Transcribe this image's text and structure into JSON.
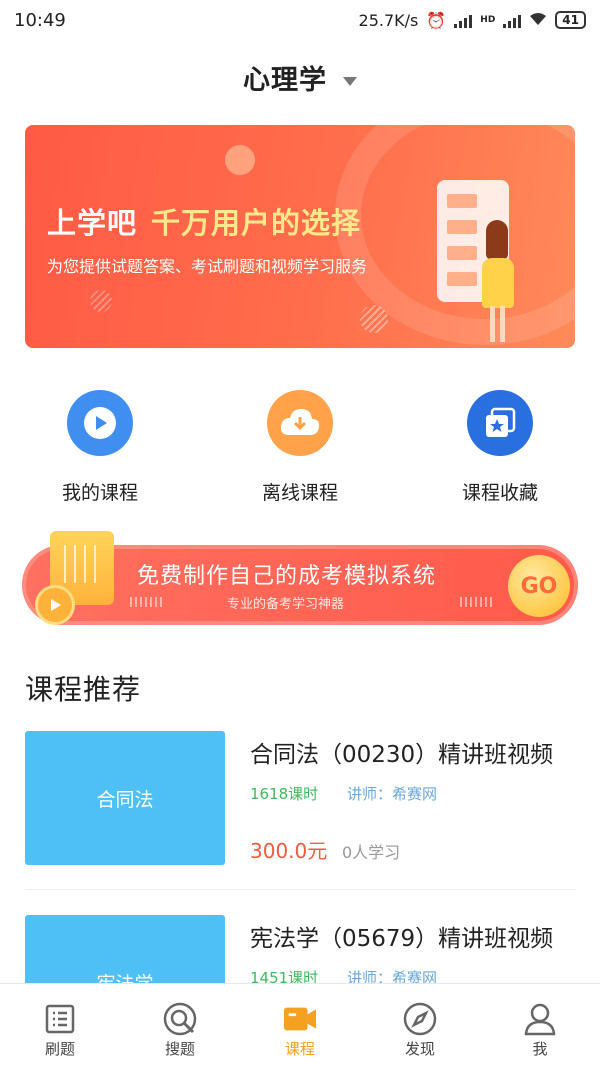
{
  "status": {
    "time": "10:49",
    "speed": "25.7K/s",
    "hd": "HD",
    "battery": "41"
  },
  "header": {
    "title": "心理学"
  },
  "banner": {
    "title_main": "上学吧",
    "title_highlight": "千万用户的选择",
    "subtitle": "为您提供试题答案、考试刷题和视频学习服务"
  },
  "quick_actions": [
    {
      "label": "我的课程",
      "icon": "play-circle-icon",
      "color": "#3f8ef0"
    },
    {
      "label": "离线课程",
      "icon": "cloud-download-icon",
      "color": "#ffa24a"
    },
    {
      "label": "课程收藏",
      "icon": "star-bookmark-icon",
      "color": "#2a6fe0"
    }
  ],
  "promo": {
    "title": "免费制作自己的成考模拟系统",
    "subtitle": "专业的备考学习神器",
    "go_label": "GO"
  },
  "section": {
    "title": "课程推荐"
  },
  "courses": [
    {
      "thumb_label": "合同法",
      "title": "合同法（00230）精讲班视频",
      "hours": "1618课时",
      "teacher": "讲师：希赛网",
      "price": "300.0元",
      "learners": "0人学习"
    },
    {
      "thumb_label": "宪法学",
      "title": "宪法学（05679）精讲班视频",
      "hours": "1451课时",
      "teacher": "讲师：希赛网"
    }
  ],
  "tabbar": [
    {
      "label": "刷题",
      "icon": "list-doc-icon"
    },
    {
      "label": "搜题",
      "icon": "search-icon"
    },
    {
      "label": "课程",
      "icon": "video-camera-icon",
      "active": true
    },
    {
      "label": "发现",
      "icon": "compass-icon"
    },
    {
      "label": "我",
      "icon": "user-icon"
    }
  ],
  "colors": {
    "accent": "#f4a020",
    "banner": "#ff5a45",
    "thumb": "#4fc0f5",
    "price": "#f15a3a",
    "hours": "#3dbb5c"
  }
}
